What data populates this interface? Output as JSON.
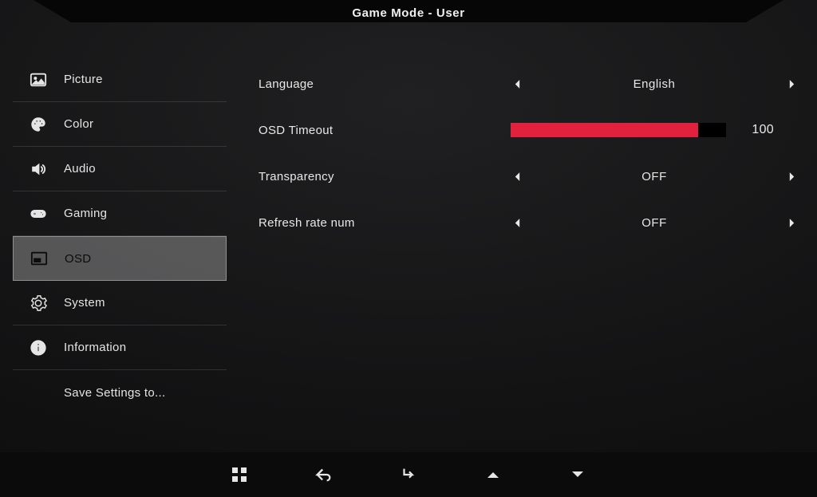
{
  "header": {
    "title": "Game Mode - User"
  },
  "sidebar": {
    "items": [
      {
        "label": "Picture",
        "icon": "picture-icon"
      },
      {
        "label": "Color",
        "icon": "palette-icon"
      },
      {
        "label": "Audio",
        "icon": "speaker-icon"
      },
      {
        "label": "Gaming",
        "icon": "gamepad-icon"
      },
      {
        "label": "OSD",
        "icon": "osd-icon",
        "active": true
      },
      {
        "label": "System",
        "icon": "gear-icon"
      },
      {
        "label": "Information",
        "icon": "info-icon"
      },
      {
        "label": "Save Settings to...",
        "icon": null
      }
    ]
  },
  "settings": {
    "language": {
      "label": "Language",
      "value": "English"
    },
    "osd_timeout": {
      "label": "OSD Timeout",
      "value": 100,
      "percent": 87
    },
    "transparency": {
      "label": "Transparency",
      "value": "OFF"
    },
    "refresh_rate_num": {
      "label": "Refresh rate num",
      "value": "OFF"
    }
  },
  "bottom_nav": [
    "menu",
    "back",
    "enter",
    "up",
    "down"
  ],
  "colors": {
    "accent": "#e2213e"
  }
}
